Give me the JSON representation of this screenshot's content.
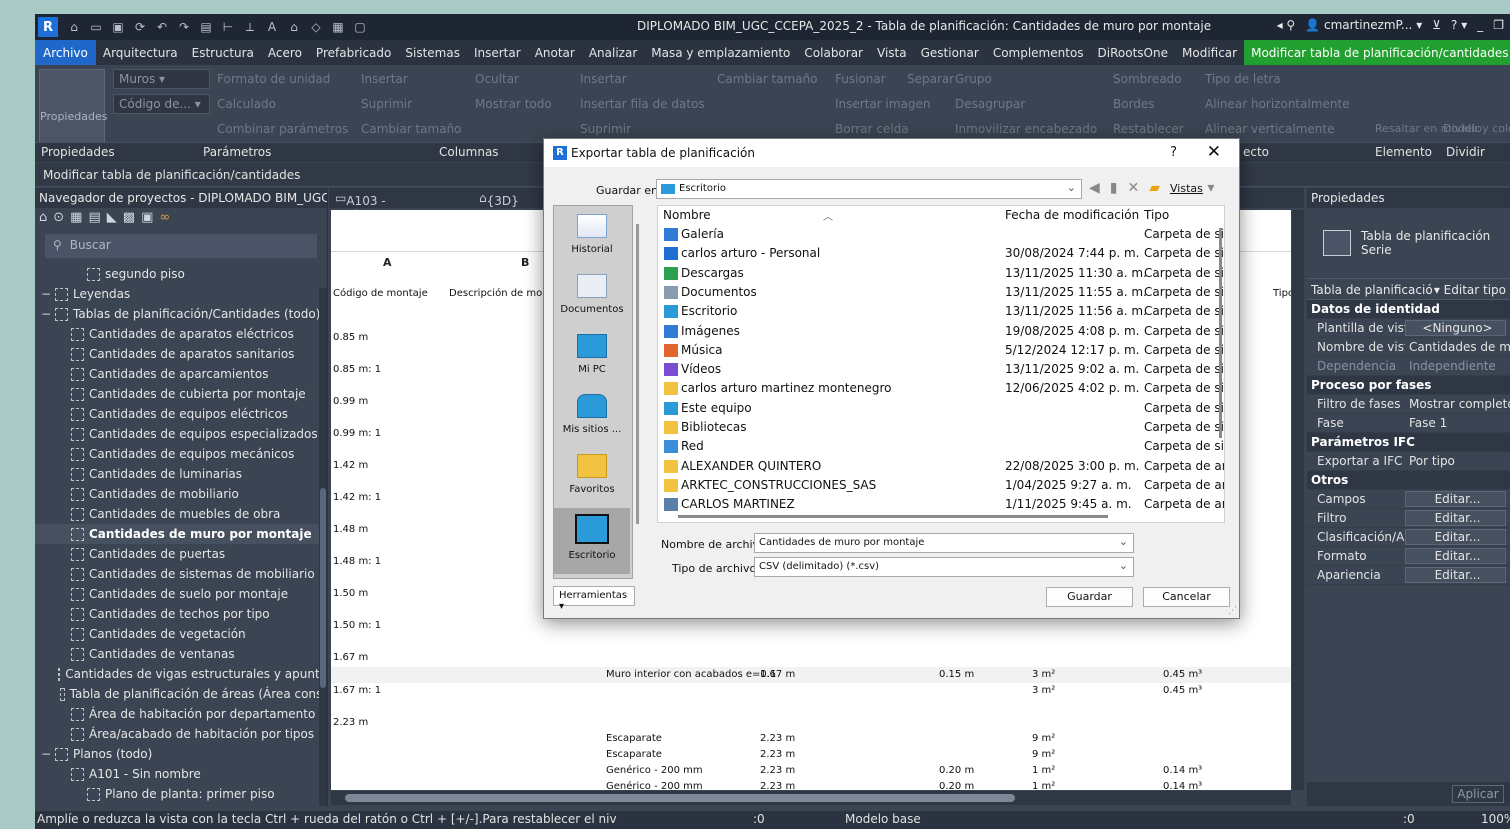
{
  "window": {
    "title": "DIPLOMADO BIM_UGC_CCEPA_2025_2 - Tabla de planificación: Cantidades de muro por montaje",
    "user": "cmartinezmP...",
    "app_logo": "R"
  },
  "menu": [
    "Archivo",
    "Arquitectura",
    "Estructura",
    "Acero",
    "Prefabricado",
    "Sistemas",
    "Insertar",
    "Anotar",
    "Analizar",
    "Masa y emplazamiento",
    "Colaborar",
    "Vista",
    "Gestionar",
    "Complementos",
    "DiRootsOne",
    "Modificar",
    "Modificar tabla de planificación/cantidades"
  ],
  "ribbon": {
    "properties_button": "Propiedades",
    "combo_category": "Muros",
    "combo_code": "Código de...",
    "items": [
      "Formato de unidad",
      "Calculado",
      "Combinar parámetros",
      "Insertar",
      "Suprimir",
      "Cambiar tamaño",
      "Ocultar",
      "Mostrar todo",
      "Insertar",
      "Insertar fila de datos",
      "Suprimir",
      "Cambiar tamaño",
      "Fusionar",
      "Separar",
      "Grupo",
      "Insertar imagen",
      "Desagrupar",
      "Borrar celda",
      "Inmovilizar encabezado",
      "Sombreado",
      "Tipo de letra",
      "Bordes",
      "Alinear horizontalmente",
      "Restablecer",
      "Alinear verticalmente",
      "Resaltar en modelo",
      "Dividir y colocar"
    ],
    "footer": [
      "Propiedades",
      "Parámetros",
      "Columnas",
      "ecto",
      "Elemento",
      "Dividir"
    ]
  },
  "context_bar": "Modificar tabla de planificación/cantidades",
  "browser": {
    "title": "Navegador de proyectos - DIPLOMADO BIM_UGC_CC...",
    "search_placeholder": "Buscar",
    "nodes": [
      {
        "label": "segundo piso",
        "indent": 2
      },
      {
        "label": "Leyendas",
        "indent": 0
      },
      {
        "label": "Tablas de planificación/Cantidades (todo)",
        "indent": 0
      },
      {
        "label": "Cantidades de aparatos eléctricos",
        "indent": 1
      },
      {
        "label": "Cantidades de aparatos sanitarios",
        "indent": 1
      },
      {
        "label": "Cantidades de aparcamientos",
        "indent": 1
      },
      {
        "label": "Cantidades de cubierta por montaje",
        "indent": 1
      },
      {
        "label": "Cantidades de equipos eléctricos",
        "indent": 1
      },
      {
        "label": "Cantidades de equipos especializados",
        "indent": 1
      },
      {
        "label": "Cantidades de equipos mecánicos",
        "indent": 1
      },
      {
        "label": "Cantidades de luminarias",
        "indent": 1
      },
      {
        "label": "Cantidades de mobiliario",
        "indent": 1
      },
      {
        "label": "Cantidades de muebles de obra",
        "indent": 1
      },
      {
        "label": "Cantidades de muro por montaje",
        "indent": 1,
        "selected": true
      },
      {
        "label": "Cantidades de puertas",
        "indent": 1
      },
      {
        "label": "Cantidades de sistemas de mobiliario",
        "indent": 1
      },
      {
        "label": "Cantidades de suelo por montaje",
        "indent": 1
      },
      {
        "label": "Cantidades de techos por tipo",
        "indent": 1
      },
      {
        "label": "Cantidades de vegetación",
        "indent": 1
      },
      {
        "label": "Cantidades de ventanas",
        "indent": 1
      },
      {
        "label": "Cantidades de vigas estructurales y apunta",
        "indent": 1
      },
      {
        "label": "Tabla de planificación de áreas (Área const",
        "indent": 1
      },
      {
        "label": "Área de habitación por departamento",
        "indent": 1
      },
      {
        "label": "Área/acabado de habitación por tipos",
        "indent": 1
      },
      {
        "label": "Planos (todo)",
        "indent": 0
      },
      {
        "label": "A101 - Sin nombre",
        "indent": 1
      },
      {
        "label": "Plano de planta: primer piso",
        "indent": 2
      }
    ]
  },
  "view_tabs": [
    "A103 - Sin nombre",
    "{3D}"
  ],
  "schedule": {
    "col_letters": [
      "A",
      "B"
    ],
    "headers": [
      "Código de montaje",
      "Descripción de mont",
      "Tipo"
    ],
    "rows": [
      {
        "code": "0.85 m",
        "grey": false
      },
      {
        "code": "0.85 m: 1",
        "grey": false
      },
      {
        "code": "0.99 m",
        "grey": false
      },
      {
        "code": "0.99 m: 1",
        "grey": false
      },
      {
        "code": "1.42 m",
        "grey": false
      },
      {
        "code": "1.42 m: 1",
        "grey": false
      },
      {
        "code": "1.48 m",
        "grey": false
      },
      {
        "code": "1.48 m: 1",
        "grey": false
      },
      {
        "code": "1.50 m",
        "grey": false
      },
      {
        "code": "1.50 m: 1",
        "grey": false
      },
      {
        "code": "1.67 m",
        "grey": false
      }
    ],
    "detail_rows": [
      {
        "desc": "Muro interior con acabados e=0.1",
        "h": "1.67 m",
        "t": "0.15 m",
        "a": "3 m²",
        "v": "0.45 m³"
      },
      {
        "code": "1.67 m: 1",
        "a": "3 m²",
        "v": "0.45 m³"
      },
      {
        "code": "2.23 m"
      },
      {
        "desc": "Escaparate",
        "h": "2.23 m",
        "a": "9 m²"
      },
      {
        "desc": "Escaparate",
        "h": "2.23 m",
        "a": "9 m²"
      },
      {
        "desc": "Genérico - 200 mm",
        "h": "2.23 m",
        "t": "0.20 m",
        "a": "1 m²",
        "v": "0.14 m³"
      },
      {
        "desc": "Genérico - 200 mm",
        "h": "2.23 m",
        "t": "0.20 m",
        "a": "1 m²",
        "v": "0.14 m³"
      }
    ]
  },
  "properties": {
    "title": "Propiedades",
    "type_name": "Tabla de planificación Serie",
    "selector": "Tabla de planificació",
    "edit_type": "Editar tipo",
    "groups": [
      {
        "name": "Datos de identidad",
        "rows": [
          {
            "k": "Plantilla de vista",
            "v": "<Ninguno>",
            "btn": true
          },
          {
            "k": "Nombre de vista",
            "v": "Cantidades de m..."
          },
          {
            "k": "Dependencia",
            "v": "Independiente",
            "dim": true
          }
        ]
      },
      {
        "name": "Proceso por fases",
        "rows": [
          {
            "k": "Filtro de fases",
            "v": "Mostrar completo"
          },
          {
            "k": "Fase",
            "v": "Fase 1"
          }
        ]
      },
      {
        "name": "Parámetros IFC",
        "rows": [
          {
            "k": "Exportar a IFC",
            "v": "Por tipo"
          }
        ]
      },
      {
        "name": "Otros",
        "rows": [
          {
            "k": "Campos",
            "v": "Editar...",
            "btn": true
          },
          {
            "k": "Filtro",
            "v": "Editar...",
            "btn": true
          },
          {
            "k": "Clasificación/A...",
            "v": "Editar...",
            "btn": true
          },
          {
            "k": "Formato",
            "v": "Editar...",
            "btn": true
          },
          {
            "k": "Apariencia",
            "v": "Editar...",
            "btn": true
          }
        ]
      }
    ],
    "apply": "Aplicar"
  },
  "status": {
    "hint": "Amplíe o reduzca la vista con la tecla Ctrl + rueda del ratón o Ctrl + [+/-].Para restablecer el niv",
    "zero1": ":0",
    "model": "Modelo base",
    "zero2": ":0",
    "zoom": "100%"
  },
  "dialog": {
    "title": "Exportar tabla de planificación",
    "help": "?",
    "save_in_label": "Guardar en:",
    "save_in_value": "Escritorio",
    "views_label": "Vistas",
    "places": [
      "Historial",
      "Documentos",
      "Mi PC",
      "Mis sitios ...",
      "Favoritos",
      "Escritorio"
    ],
    "columns": [
      "Nombre",
      "Fecha de modificación",
      "Tipo"
    ],
    "files": [
      {
        "name": "Galería",
        "date": "",
        "type": "Carpeta de sis",
        "color": "#2f7bd6"
      },
      {
        "name": "carlos arturo - Personal",
        "date": "30/08/2024 7:44 p. m.",
        "type": "Carpeta de sis",
        "color": "#1f6fd1"
      },
      {
        "name": "Descargas",
        "date": "13/11/2025 11:30 a. m.",
        "type": "Carpeta de sis",
        "color": "#2e9e4f"
      },
      {
        "name": "Documentos",
        "date": "13/11/2025 11:55 a. m.",
        "type": "Carpeta de sis",
        "color": "#8a9bb0"
      },
      {
        "name": "Escritorio",
        "date": "13/11/2025 11:56 a. m.",
        "type": "Carpeta de sis",
        "color": "#2a9bd8"
      },
      {
        "name": "Imágenes",
        "date": "19/08/2025 4:08 p. m.",
        "type": "Carpeta de sis",
        "color": "#2f7bd6"
      },
      {
        "name": "Música",
        "date": "5/12/2024 12:17 p. m.",
        "type": "Carpeta de sis",
        "color": "#e0662e"
      },
      {
        "name": "Vídeos",
        "date": "13/11/2025 9:02 a. m.",
        "type": "Carpeta de sis",
        "color": "#7a4cd1"
      },
      {
        "name": "carlos arturo martinez montenegro",
        "date": "12/06/2025 4:02 p. m.",
        "type": "Carpeta de sis",
        "color": "#f2c340"
      },
      {
        "name": "Este equipo",
        "date": "",
        "type": "Carpeta de sis",
        "color": "#2a9bd8"
      },
      {
        "name": "Bibliotecas",
        "date": "",
        "type": "Carpeta de sis",
        "color": "#f2c340"
      },
      {
        "name": "Red",
        "date": "",
        "type": "Carpeta de sis",
        "color": "#3a8fd8"
      },
      {
        "name": "ALEXANDER QUINTERO",
        "date": "22/08/2025 3:00 p. m.",
        "type": "Carpeta de ar",
        "color": "#f2c340"
      },
      {
        "name": "ARKTEC_CONSTRUCCIONES_SAS",
        "date": "1/04/2025 9:27 a. m.",
        "type": "Carpeta de ar",
        "color": "#f2c340"
      },
      {
        "name": "CARLOS MARTINEZ",
        "date": "1/11/2025 9:45 a. m.",
        "type": "Carpeta de ar",
        "color": "#5a7fa8"
      }
    ],
    "filename_label": "Nombre de archivo:",
    "filename_value": "Cantidades de muro por montaje",
    "filetype_label": "Tipo de archivos:",
    "filetype_value": "CSV (delimitado) (*.csv)",
    "tools_label": "Herramientas",
    "save_label": "Guardar",
    "cancel_label": "Cancelar"
  },
  "colors": {
    "accent_blue": "#1f68c9",
    "context_green": "#22a02f",
    "dark_bg": "#3b4453"
  }
}
